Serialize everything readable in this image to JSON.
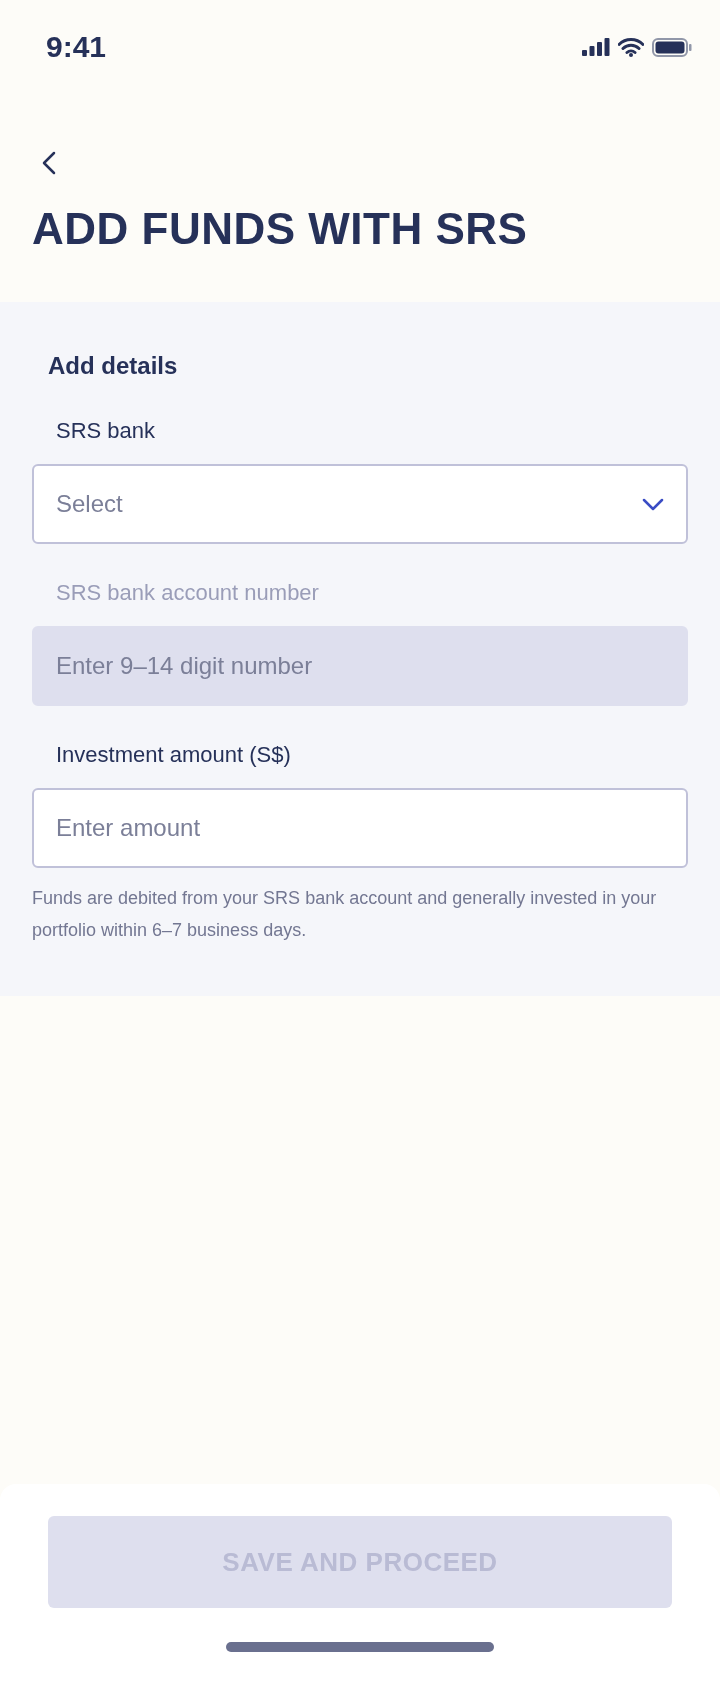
{
  "status_bar": {
    "time": "9:41"
  },
  "header": {
    "title": "ADD FUNDS WITH SRS"
  },
  "form": {
    "section_title": "Add details",
    "fields": [
      {
        "kind": "dropdown",
        "label": "SRS bank",
        "placeholder": "Select",
        "disabled": false
      },
      {
        "kind": "text",
        "label": "SRS bank account number",
        "placeholder": "Enter 9–14 digit number",
        "disabled": true
      },
      {
        "kind": "text",
        "label": "Investment amount (S$)",
        "placeholder": "Enter amount",
        "disabled": false
      }
    ],
    "note": "Funds are debited from your SRS bank account and generally invested in your portfolio within 6–7 business days."
  },
  "footer": {
    "button": {
      "label": "SAVE AND PROCEED",
      "disabled": true
    }
  }
}
